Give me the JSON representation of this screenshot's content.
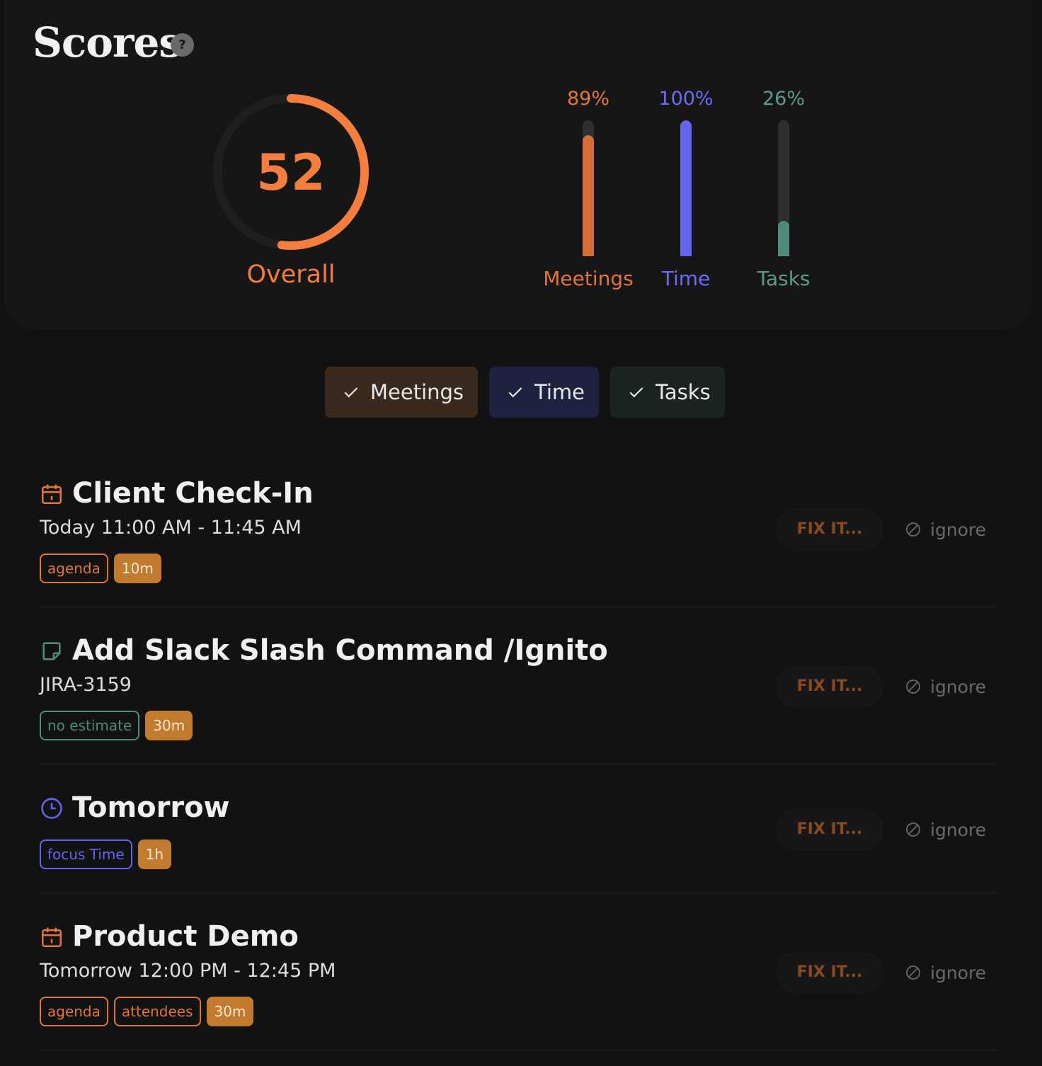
{
  "header": {
    "title": "Scores"
  },
  "overall": {
    "value": "52",
    "label": "Overall",
    "progress": 0.52,
    "color": "#f47e3e"
  },
  "bars": [
    {
      "pct_label": "89%",
      "label": "Meetings",
      "fraction": 0.89,
      "color": "#e0763a",
      "fill": "#d66e35"
    },
    {
      "pct_label": "100%",
      "label": "Time",
      "fraction": 1.0,
      "color": "#6c6cf5",
      "fill": "#6565f0"
    },
    {
      "pct_label": "26%",
      "label": "Tasks",
      "fraction": 0.26,
      "color": "#5a9b8c",
      "fill": "#4f8a7c"
    }
  ],
  "filters": [
    {
      "label": "Meetings",
      "bg": "#3a2a1e",
      "icon": "check-icon"
    },
    {
      "label": "Time",
      "bg": "#1e2140",
      "icon": "check-icon"
    },
    {
      "label": "Tasks",
      "bg": "#1b2323",
      "icon": "check-icon"
    }
  ],
  "items": [
    {
      "title": "Client Check-In",
      "subtitle": "Today 11:00 AM - 11:45 AM",
      "icon": "calendar-icon",
      "tags": [
        {
          "label": "agenda",
          "color": "#e0763a"
        }
      ],
      "duration": "10m",
      "fix_label": "FIX IT...",
      "ignore_label": "ignore"
    },
    {
      "title": "Add Slack Slash Command /Ignito",
      "subtitle": "JIRA-3159",
      "icon": "sticky-note-icon",
      "tags": [
        {
          "label": "no estimate",
          "color": "#4f8a7c"
        }
      ],
      "duration": "30m",
      "fix_label": "FIX IT...",
      "ignore_label": "ignore"
    },
    {
      "title": "Tomorrow",
      "subtitle": "",
      "icon": "clock-icon",
      "tags": [
        {
          "label": "focus Time",
          "color": "#6565f0"
        }
      ],
      "duration": "1h",
      "fix_label": "FIX IT...",
      "ignore_label": "ignore"
    },
    {
      "title": "Product Demo",
      "subtitle": "Tomorrow 12:00 PM - 12:45 PM",
      "icon": "calendar-icon",
      "tags": [
        {
          "label": "agenda",
          "color": "#e0763a"
        },
        {
          "label": "attendees",
          "color": "#e0763a"
        }
      ],
      "duration": "30m",
      "fix_label": "FIX IT...",
      "ignore_label": "ignore"
    }
  ]
}
